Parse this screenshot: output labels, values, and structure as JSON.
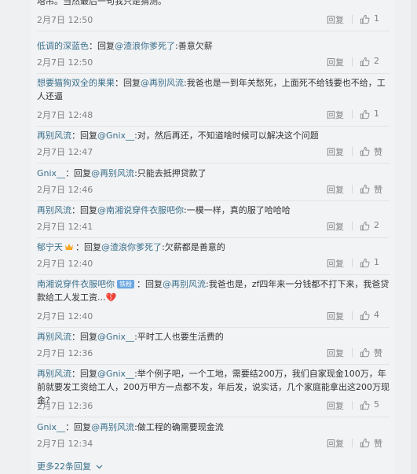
{
  "comments": [
    {
      "segments": [
        {
          "t": "塔吊。当然最后一句我只是猜测。",
          "c": ""
        }
      ],
      "time": "2月7日 12:50",
      "likes": "1"
    },
    {
      "segments": [
        {
          "t": "低调的深蓝色",
          "c": "name"
        },
        {
          "t": "：回复",
          "c": ""
        },
        {
          "t": "@渣浪你爹死了",
          "c": "mention"
        },
        {
          "t": ":善意欠薪",
          "c": ""
        }
      ],
      "time": "2月7日 12:50",
      "likes": "2"
    },
    {
      "segments": [
        {
          "t": "想要猫狗双全的果果",
          "c": "name"
        },
        {
          "t": "：回复",
          "c": ""
        },
        {
          "t": "@再别风流",
          "c": "mention"
        },
        {
          "t": ":我爸也是一到年关愁死，上面死不给钱要也不给，工人还逼",
          "c": ""
        }
      ],
      "time": "2月7日 12:48",
      "likes": "1"
    },
    {
      "segments": [
        {
          "t": "再别风流",
          "c": "name"
        },
        {
          "t": "：回复",
          "c": ""
        },
        {
          "t": "@Gnix__",
          "c": "mention"
        },
        {
          "t": ":对，然后再还，不知道啥时候可以解决这个问题",
          "c": ""
        }
      ],
      "time": "2月7日 12:47",
      "likes": "赞"
    },
    {
      "segments": [
        {
          "t": "Gnix__",
          "c": "name"
        },
        {
          "t": "：回复",
          "c": ""
        },
        {
          "t": "@再别风流",
          "c": "mention"
        },
        {
          "t": ":只能去抵押贷款了",
          "c": ""
        }
      ],
      "time": "2月7日 12:46",
      "likes": "赞"
    },
    {
      "segments": [
        {
          "t": "再别风流",
          "c": "name"
        },
        {
          "t": "：回复",
          "c": ""
        },
        {
          "t": "@南湘说穿件衣服吧你",
          "c": "mention"
        },
        {
          "t": ":一模一样，真的服了哈哈哈",
          "c": ""
        }
      ],
      "time": "2月7日 12:41",
      "likes": "2"
    },
    {
      "segments": [
        {
          "t": "郁宁天",
          "c": "name"
        },
        {
          "t": "crown",
          "c": "crown"
        },
        {
          "t": "：回复",
          "c": ""
        },
        {
          "t": "@渣浪你爹死了",
          "c": "mention"
        },
        {
          "t": ":欠薪都是善意的",
          "c": ""
        }
      ],
      "time": "2月7日 12:40",
      "likes": "1"
    },
    {
      "segments": [
        {
          "t": "南湘说穿件衣服吧你",
          "c": "name"
        },
        {
          "t": "铁粉",
          "c": "badge"
        },
        {
          "t": "：回复",
          "c": ""
        },
        {
          "t": "@再别风流",
          "c": "mention"
        },
        {
          "t": ":我爸也是，zf四年来一分钱都不打下来，我爸贷款给工人发工资...",
          "c": ""
        },
        {
          "t": "💔",
          "c": "emoji"
        }
      ],
      "time": "2月7日 12:40",
      "likes": "4"
    },
    {
      "segments": [
        {
          "t": "再别风流",
          "c": "name"
        },
        {
          "t": "：回复",
          "c": ""
        },
        {
          "t": "@Gnix__",
          "c": "mention"
        },
        {
          "t": ":平时工人也要生活费的",
          "c": ""
        }
      ],
      "time": "2月7日 12:36",
      "likes": "赞"
    },
    {
      "segments": [
        {
          "t": "再别风流",
          "c": "name"
        },
        {
          "t": "：回复",
          "c": ""
        },
        {
          "t": "@Gnix__",
          "c": "mention"
        },
        {
          "t": ":举个例子吧，一个工地，需要结200万，我们自家现金100万，年前就要发工资给工人，200万甲方一点都不发，年后发，说实话，几个家庭能拿出这200万现金？",
          "c": ""
        }
      ],
      "time": "2月7日 12:36",
      "likes": "5"
    },
    {
      "segments": [
        {
          "t": "Gnix__",
          "c": "name"
        },
        {
          "t": "：回复",
          "c": ""
        },
        {
          "t": "@再别风流",
          "c": "mention"
        },
        {
          "t": ":做工程的确需要现金流",
          "c": ""
        }
      ],
      "time": "2月7日 12:34",
      "likes": "赞"
    }
  ],
  "reply_label": "回复",
  "more_replies": "更多22条回复",
  "icons": {
    "like": "thumbs-up-icon",
    "more": "chevron-down-icon"
  }
}
